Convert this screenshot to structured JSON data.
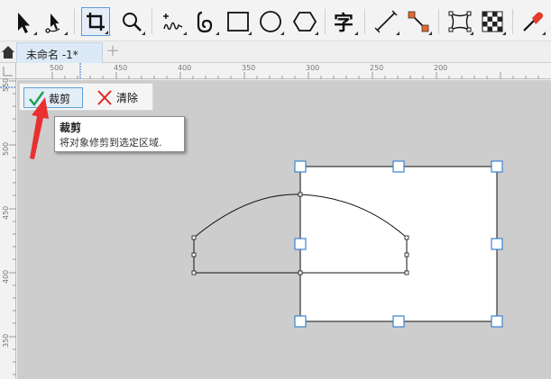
{
  "tabs": {
    "document_title": "未命名 -1*",
    "new_tab_symbol": "+"
  },
  "crop_toolbar": {
    "crop_label": "裁剪",
    "clear_label": "清除"
  },
  "tooltip": {
    "title": "裁剪",
    "description": "将对象修剪到选定区域."
  },
  "toolbar_icons": [
    "pick-tool-icon",
    "shape-tool-icon",
    "crop-tool-icon",
    "zoom-tool-icon",
    "freehand-tool-icon",
    "artistic-media-icon",
    "rectangle-tool-icon",
    "ellipse-tool-icon",
    "polygon-tool-icon",
    "text-tool-icon",
    "parallel-dimension-icon",
    "connector-tool-icon",
    "envelope-tool-icon",
    "transparency-tool-icon",
    "eyedropper-tool-icon"
  ],
  "ruler": {
    "top_labels": [
      "500",
      "450",
      "400",
      "350",
      "300",
      "250",
      "200"
    ],
    "left_labels": [
      "550",
      "500",
      "450",
      "400",
      "350"
    ]
  },
  "colors": {
    "accent": "#3a84d0",
    "annotation_arrow": "#e8312f",
    "crop_check": "#1e9e54",
    "clear_x": "#e02424",
    "canvas": "#cdcdcd"
  }
}
